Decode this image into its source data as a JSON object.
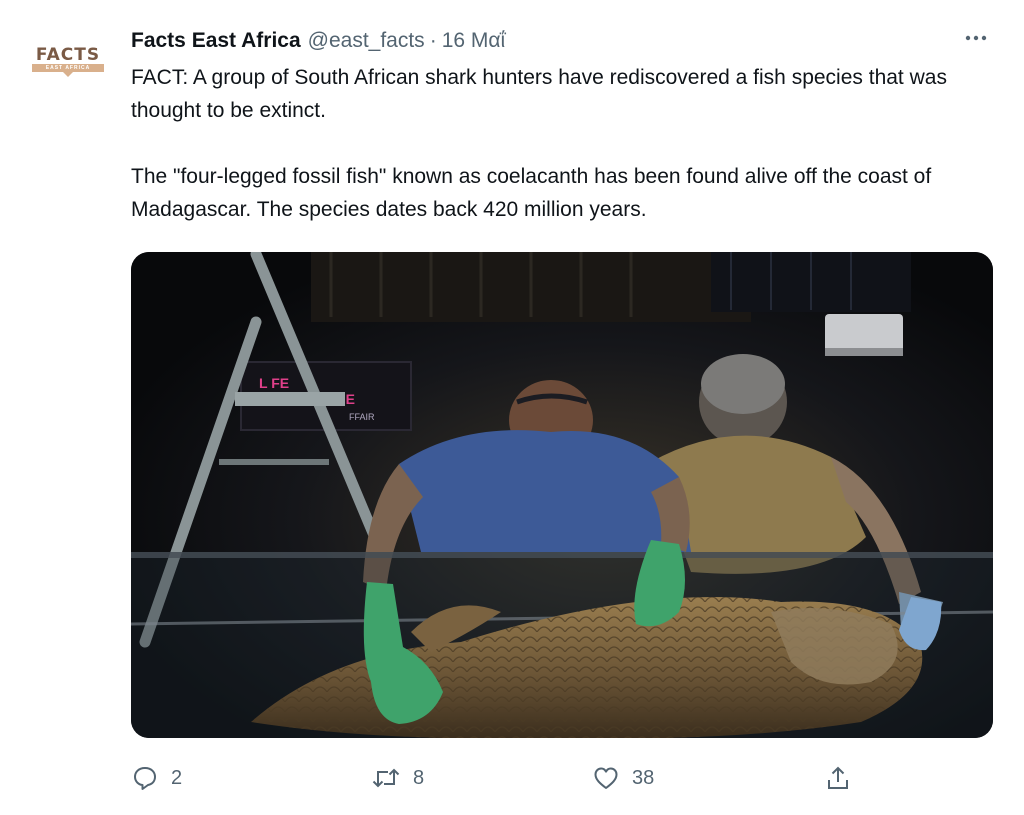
{
  "author": {
    "avatar_logo_text": "FACTS",
    "avatar_sub_text": "EAST AFRICA",
    "display_name": "Facts East Africa",
    "handle": "@east_facts",
    "separator": "·",
    "date": "16 Μαΐ"
  },
  "tweet": {
    "paragraph_1": "FACT: A group of South African shark hunters have rediscovered a fish species that was thought to be extinct.",
    "paragraph_2": "The \"four-legged fossil fish\" known as coelacanth has been found alive off the coast of Madagascar. The species dates back 420 million years."
  },
  "media": {
    "sign_text_1": "L  FE",
    "sign_text_2": "THE",
    "sign_text_3": "FFAIR"
  },
  "actions": {
    "reply_count": "2",
    "retweet_count": "8",
    "like_count": "38"
  },
  "icons": {
    "more": "more-horizontal-icon",
    "reply": "reply-icon",
    "retweet": "retweet-icon",
    "like": "heart-icon",
    "share": "share-icon"
  },
  "colors": {
    "text_primary": "#0f1419",
    "text_secondary": "#536471",
    "avatar_brown": "#7a5a45",
    "avatar_tan": "#d9b08c"
  }
}
